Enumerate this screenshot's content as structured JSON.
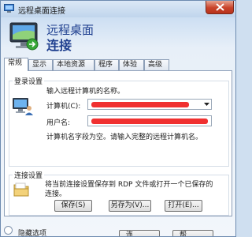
{
  "window": {
    "title": "远程桌面连接",
    "icon": "remote-desktop-icon",
    "close_icon": "close-icon"
  },
  "header": {
    "line1": "远程桌面",
    "line2": "连接",
    "icon": "monitor-icon"
  },
  "tabs": [
    {
      "label": "常规",
      "active": true
    },
    {
      "label": "显示",
      "active": false
    },
    {
      "label": "本地资源",
      "active": false
    },
    {
      "label": "程序",
      "active": false
    },
    {
      "label": "体验",
      "active": false
    },
    {
      "label": "高级",
      "active": false
    }
  ],
  "login": {
    "group_title": "登录设置",
    "prompt": "输入远程计算机的名称。",
    "computer_label": "计算机(C):",
    "username_label": "用户名:",
    "hint": "计算机名字段为空。请输入完整的远程计算机名。"
  },
  "connection": {
    "group_title": "连接设置",
    "description": "将当前连接设置保存到 RDP 文件或打开一个已保存的连接。",
    "buttons": {
      "save": "保存(S)",
      "save_as": "另存为(V)...",
      "open": "打开(E)..."
    }
  },
  "footer": {
    "options_label": "隐藏选项",
    "connect_label": "连",
    "help_label": "帮"
  },
  "colors": {
    "accent_text": "#1f3f8f",
    "redaction": "#f03030"
  }
}
